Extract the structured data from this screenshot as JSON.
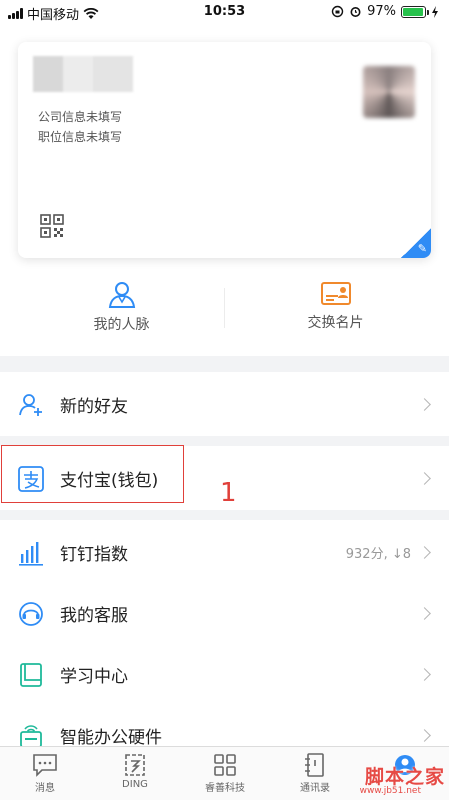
{
  "status_bar": {
    "carrier": "中国移动",
    "time": "10:53",
    "battery": "97%",
    "battery_level": 0.97
  },
  "profile_card": {
    "company": "公司信息未填写",
    "position": "职位信息未填写"
  },
  "quick_actions": [
    {
      "label": "我的人脉",
      "icon": "contacts-person-icon"
    },
    {
      "label": "交换名片",
      "icon": "business-card-icon"
    }
  ],
  "menu": {
    "new_friends": "新的好友",
    "alipay": "支付宝(钱包)",
    "dingtalk_index": "钉钉指数",
    "dingtalk_index_value": "932分, ↓8",
    "customer_service": "我的客服",
    "learning_center": "学习中心",
    "smart_hardware": "智能办公硬件"
  },
  "annotation": "1",
  "tabs": [
    {
      "label": "消息",
      "icon": "message-icon"
    },
    {
      "label": "DING",
      "icon": "ding-icon"
    },
    {
      "label": "睿善科技",
      "icon": "workbench-grid-icon"
    },
    {
      "label": "通讯录",
      "icon": "address-book-icon"
    }
  ],
  "watermark": {
    "text": "脚本之家",
    "url": "www.jb51.net"
  },
  "colors": {
    "accent": "#2f8cf5",
    "orange": "#f0892c",
    "annotation_red": "#e0403a"
  }
}
